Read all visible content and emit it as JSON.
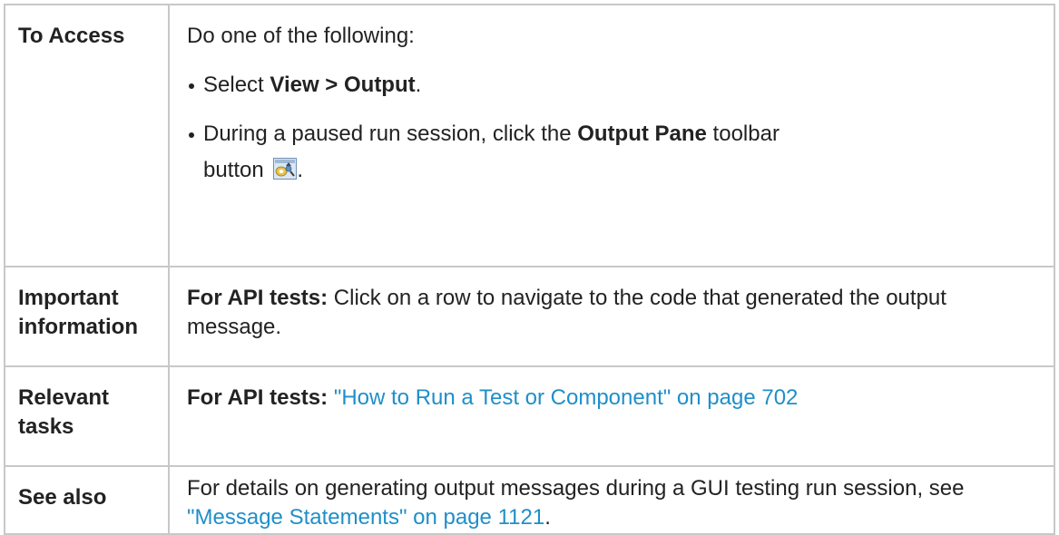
{
  "rows": {
    "access": {
      "label": "To Access",
      "intro": "Do one of the following:",
      "item1": {
        "prefix": "Select ",
        "bold": "View > Output",
        "suffix": "."
      },
      "item2": {
        "prefix": "During a paused run session, click the ",
        "bold": "Output Pane",
        "suffix": " toolbar",
        "line2": "button",
        "end": ".",
        "icon": "output-pane-icon"
      }
    },
    "important": {
      "label": "Important information",
      "bold": "For API tests:",
      "text": " Click on a row to navigate to the code that generated the output message."
    },
    "tasks": {
      "label": "Relevant tasks",
      "bold": "For API tests:",
      "link": "\"How to Run a Test or Component\" on page 702"
    },
    "see_also": {
      "label": "See also",
      "text": "For details on generating output messages during a GUI testing run session, see ",
      "link": "\"Message Statements\" on page 1121",
      "end": "."
    }
  },
  "colors": {
    "link": "#1f8fc9",
    "border": "#c8c8c8",
    "text": "#222222"
  }
}
